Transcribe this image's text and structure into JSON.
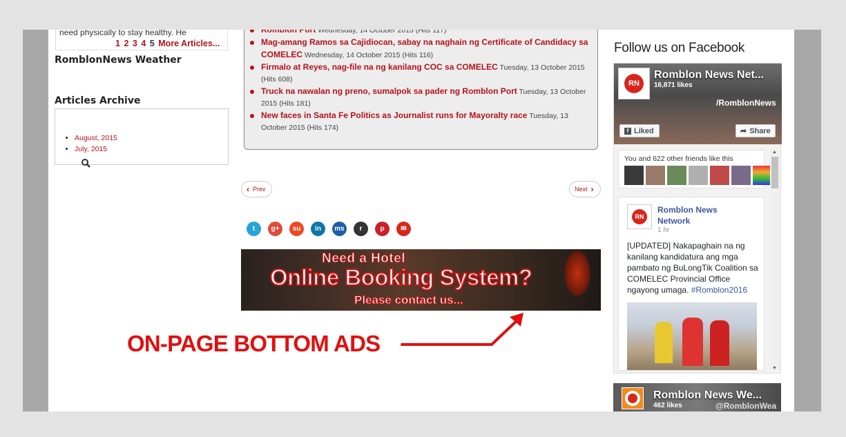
{
  "left": {
    "snippet": "need physically to stay healthy. He",
    "pagination": [
      "1",
      "2",
      "3",
      "4"
    ],
    "pagination_current": "5",
    "more_articles": "More Articles...",
    "weather_heading": "RomblonNews Weather",
    "archive_heading": "Articles Archive",
    "archive_items": [
      "August, 2015",
      "July, 2015"
    ]
  },
  "news": [
    {
      "title": "Romblon Port",
      "meta": "Wednesday, 14 October 2015 (Hits 117)"
    },
    {
      "title": "Mag-amang Ramos sa Cajidiocan, sabay na naghain ng Certificate of Candidacy sa COMELEC",
      "meta": "Wednesday, 14 October 2015 (Hits 116)"
    },
    {
      "title": "Firmalo at Reyes, nag-file na ng kanilang COC sa COMELEC",
      "meta": "Tuesday, 13 October 2015 (Hits 608)"
    },
    {
      "title": "Truck na nawalan ng preno, sumalpok sa pader ng Romblon Port",
      "meta": "Tuesday, 13 October 2015 (Hits 181)"
    },
    {
      "title": "New faces in Santa Fe Politics as Journalist runs for Mayoralty race",
      "meta": "Tuesday, 13 October 2015 (Hits 174)"
    }
  ],
  "nav": {
    "prev": "Prev",
    "next": "Next"
  },
  "social": [
    {
      "icon": "twitter-icon",
      "glyph": "t",
      "color": "#2aa3d8"
    },
    {
      "icon": "google-plus-icon",
      "glyph": "g+",
      "color": "#dd4b39"
    },
    {
      "icon": "stumbleupon-icon",
      "glyph": "su",
      "color": "#eb4823"
    },
    {
      "icon": "linkedin-icon",
      "glyph": "in",
      "color": "#0e76a8"
    },
    {
      "icon": "myspace-icon",
      "glyph": "ms",
      "color": "#1d5ea8"
    },
    {
      "icon": "reddit-icon",
      "glyph": "r",
      "color": "#333333"
    },
    {
      "icon": "pinterest-icon",
      "glyph": "p",
      "color": "#cb2027"
    },
    {
      "icon": "email-icon",
      "glyph": "✉",
      "color": "#d9261c"
    }
  ],
  "ad": {
    "line1": "Need a Hotel",
    "line2": "Online Booking System?",
    "line3": "Please contact us..."
  },
  "callout": "ON-PAGE BOTTOM ADS",
  "facebook": {
    "heading": "Follow us on Facebook",
    "page_name": "Romblon News Net...",
    "likes": "16,871 likes",
    "handle": "/RomblonNews",
    "liked_label": "Liked",
    "share_label": "Share",
    "friends_text": "You and 622 other friends like this",
    "post_author": "Romblon News Network",
    "post_time": "1 hr",
    "post_text": "[UPDATED] Nakapaghain na ng kanilang kandidatura ang mga pambato ng BuLongTik Coalition sa COMELEC Provincial Office ngayong umaga.",
    "post_tag": "#Romblon2016",
    "logo_text": "RN",
    "page2_name": "Romblon News We...",
    "page2_likes": "462 likes",
    "page2_handle": "@RomblonWea"
  },
  "colors": {
    "accent": "#b5121b",
    "callout": "#e01010",
    "fb_blue": "#3b5998"
  }
}
